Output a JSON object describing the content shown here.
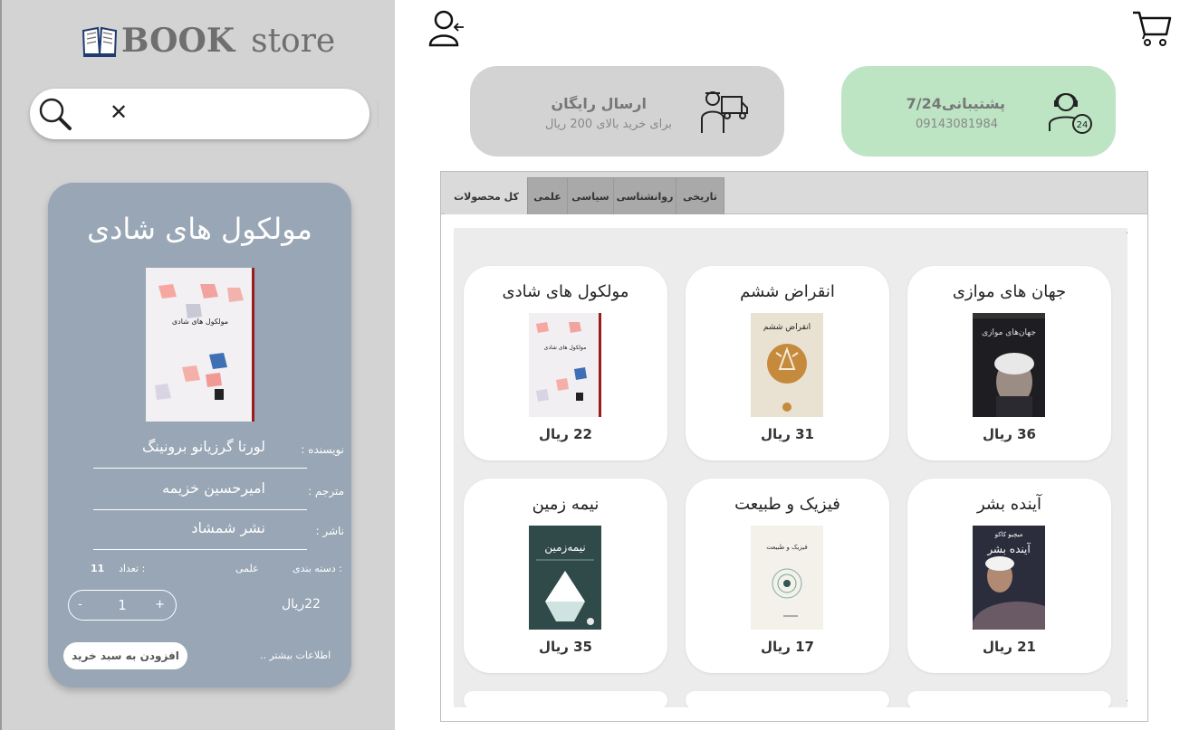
{
  "logo": {
    "brand_bold": "BOOK",
    "brand_rest": "store"
  },
  "search": {
    "value": "",
    "placeholder": ""
  },
  "detail": {
    "title": "مولکول های شادی",
    "cover_title": "مولکول های شادی",
    "author_label": "نویسنده :",
    "author": "لورتا گرزیانو برونینگ",
    "translator_label": "مترجم :",
    "translator": "امیرحسین خزیمه",
    "publisher_label": "ناشر :",
    "publisher": "نشر شمشاد",
    "category_label": "دسته بندی :",
    "category": "علمی",
    "count_label": "تعداد :",
    "count": "11",
    "quantity": "1",
    "minus": "-",
    "plus": "+",
    "price": "22ریال",
    "add_to_cart": "افزودن به سبد خرید",
    "more_info": "اطلاعات بیشتر .."
  },
  "banners": {
    "free_shipping": {
      "title": "ارسال رایگان",
      "subtitle": "برای خرید بالای 200 ریال"
    },
    "support": {
      "title": "پشتیبانی7/24",
      "phone": "09143081984"
    }
  },
  "tabs": [
    {
      "label": "کل محصولات",
      "active": true
    },
    {
      "label": "علمی",
      "active": false
    },
    {
      "label": "سیاسی",
      "active": false
    },
    {
      "label": "روانشناسی",
      "active": false
    },
    {
      "label": "تاریخی",
      "active": false
    }
  ],
  "products": [
    {
      "name": "جهان های موازی",
      "price": "36  ریال",
      "cover_color": "#1e1e22"
    },
    {
      "name": "انقراض ششم",
      "price": "31  ریال",
      "cover_color": "#e9e2d2"
    },
    {
      "name": "مولکول های شادی",
      "price": "22  ریال",
      "cover_color": "#f1eff1"
    },
    {
      "name": "آینده بشر",
      "price": "21  ریال",
      "cover_color": "#2b2d3c"
    },
    {
      "name": "فیزیک و طبیعت",
      "price": "17  ریال",
      "cover_color": "#f4f1ea"
    },
    {
      "name": "نیمه زمین",
      "price": "35  ریال",
      "cover_color": "#2f4a48"
    }
  ],
  "icons": [
    "book-logo-icon",
    "search-icon",
    "close-icon",
    "user-login-icon",
    "cart-icon",
    "delivery-icon",
    "support-agent-icon"
  ]
}
